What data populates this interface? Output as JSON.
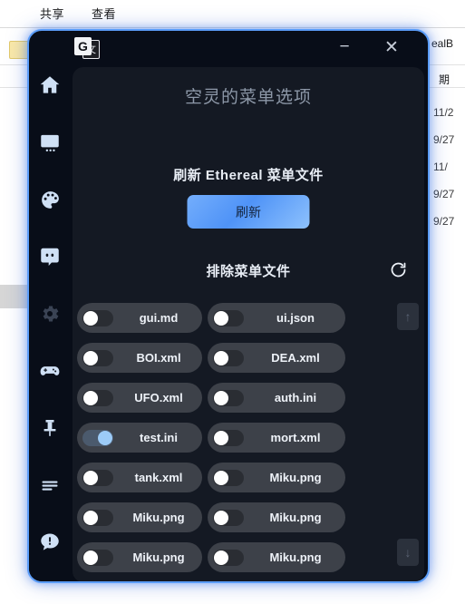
{
  "explorer": {
    "menu_items": [
      "共享",
      "查看"
    ],
    "column_name_header": "ealB",
    "column_date_header": "期",
    "file_dates": [
      "11/2",
      "9/27",
      "11/",
      "9/27",
      "9/27"
    ]
  },
  "window": {
    "app_icon": "google-translate-icon",
    "minimize_label": "−",
    "close_label": "✕"
  },
  "sidebar": {
    "items": [
      {
        "icon": "home-icon",
        "name": "home"
      },
      {
        "icon": "window-icon",
        "name": "window"
      },
      {
        "icon": "palette-icon",
        "name": "palette"
      },
      {
        "icon": "discord-icon",
        "name": "discord"
      },
      {
        "icon": "gear-icon",
        "name": "settings"
      },
      {
        "icon": "gamepad-icon",
        "name": "games"
      },
      {
        "icon": "pin-icon",
        "name": "pin"
      },
      {
        "icon": "menu-lines-icon",
        "name": "menu"
      },
      {
        "icon": "alert-bubble-icon",
        "name": "alert"
      }
    ]
  },
  "panel": {
    "title": "空灵的菜单选项",
    "refresh_heading": "刷新 Ethereal 菜单文件",
    "refresh_button": "刷新",
    "exclude_heading": "排除菜单文件",
    "exclude_refresh_icon": "refresh-icon",
    "scroll_up_icon": "↑",
    "scroll_down_icon": "↓"
  },
  "toggles": [
    {
      "label": "gui.md",
      "on": false
    },
    {
      "label": "ui.json",
      "on": false
    },
    {
      "label": "BOI.xml",
      "on": false
    },
    {
      "label": "DEA.xml",
      "on": false
    },
    {
      "label": "UFO.xml",
      "on": false
    },
    {
      "label": "auth.ini",
      "on": false
    },
    {
      "label": "test.ini",
      "on": true
    },
    {
      "label": "mort.xml",
      "on": false
    },
    {
      "label": "tank.xml",
      "on": false
    },
    {
      "label": "Miku.png",
      "on": false
    },
    {
      "label": "Miku.png",
      "on": false
    },
    {
      "label": "Miku.png",
      "on": false
    },
    {
      "label": "Miku.png",
      "on": false
    },
    {
      "label": "Miku.png",
      "on": false
    }
  ],
  "colors": {
    "window_border": "#5b9df9",
    "panel_bg": "#141923",
    "accent": "#4f93f7",
    "toggle_on": "#9ccbf7"
  }
}
